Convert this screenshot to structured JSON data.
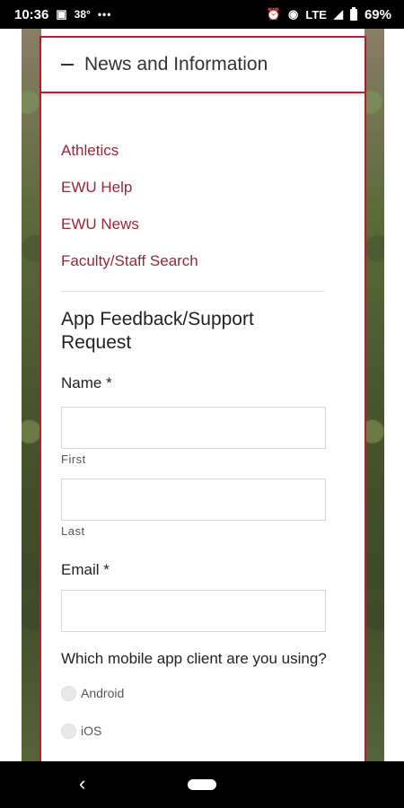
{
  "status_bar": {
    "time": "10:36",
    "temp": "38°",
    "network": "LTE",
    "battery": "69%"
  },
  "card": {
    "title": "News and Information",
    "links": [
      "Athletics",
      "EWU Help",
      "EWU News",
      "Faculty/Staff Search"
    ]
  },
  "form": {
    "title": "App Feedback/Support Request",
    "name_label": "Name *",
    "first_sub": "First",
    "last_sub": "Last",
    "email_label": "Email *",
    "question": "Which mobile app client are you using?",
    "options": [
      "Android",
      "iOS"
    ]
  },
  "colors": {
    "accent": "#b0222e",
    "link": "#9b2436"
  }
}
